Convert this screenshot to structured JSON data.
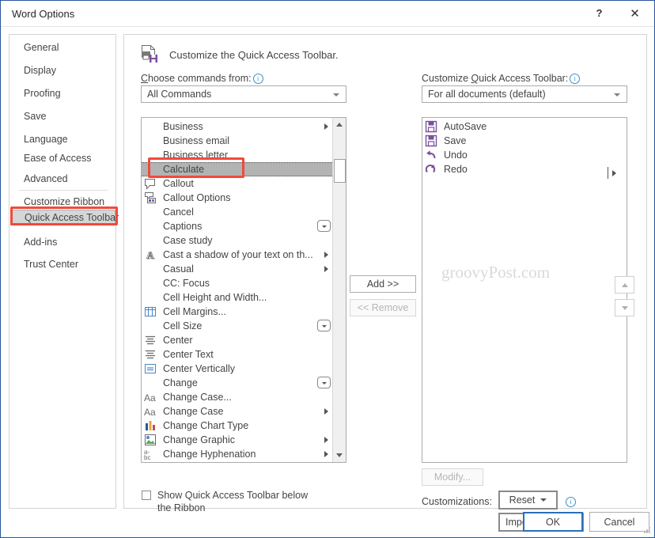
{
  "window": {
    "title": "Word Options",
    "help_label": "?",
    "close_label": "✕"
  },
  "sidebar": {
    "items": [
      {
        "label": "General",
        "selected": false
      },
      {
        "label": "Display",
        "selected": false
      },
      {
        "label": "Proofing",
        "selected": false
      },
      {
        "label": "Save",
        "selected": false
      },
      {
        "label": "Language",
        "selected": false
      },
      {
        "label": "Ease of Access",
        "selected": false
      },
      {
        "label": "Advanced",
        "selected": false
      },
      {
        "label": "Customize Ribbon",
        "selected": false
      },
      {
        "label": "Quick Access Toolbar",
        "selected": true
      },
      {
        "label": "Add-ins",
        "selected": false
      },
      {
        "label": "Trust Center",
        "selected": false
      }
    ]
  },
  "pane": {
    "heading": "Customize the Quick Access Toolbar.",
    "choose_commands_label": "Choose commands from:",
    "choose_commands_value": "All Commands",
    "customize_qat_label": "Customize Quick Access Toolbar:",
    "customize_qat_value": "For all documents (default)",
    "add_button": "Add >>",
    "remove_button": "<< Remove",
    "modify_button": "Modify...",
    "customizations_label": "Customizations:",
    "reset_button": "Reset",
    "import_export_button": "Import/Export",
    "move_up_label": "Move Up",
    "move_down_label": "Move Down",
    "show_below_ribbon_label": "Show Quick Access Toolbar below the Ribbon",
    "show_below_ribbon_checked": false,
    "watermark": "groovyPost.com"
  },
  "command_list": [
    {
      "label": "Business",
      "icon": "none",
      "submenu": true,
      "dropdown": false,
      "selected": false
    },
    {
      "label": "Business email",
      "icon": "none",
      "submenu": false,
      "dropdown": false,
      "selected": false
    },
    {
      "label": "Business letter",
      "icon": "none",
      "submenu": false,
      "dropdown": false,
      "selected": false
    },
    {
      "label": "Calculate",
      "icon": "none",
      "submenu": false,
      "dropdown": false,
      "selected": true
    },
    {
      "label": "Callout",
      "icon": "callout-icon",
      "submenu": false,
      "dropdown": false,
      "selected": false
    },
    {
      "label": "Callout Options",
      "icon": "callout-options-icon",
      "submenu": false,
      "dropdown": false,
      "selected": false
    },
    {
      "label": "Cancel",
      "icon": "none",
      "submenu": false,
      "dropdown": false,
      "selected": false
    },
    {
      "label": "Captions",
      "icon": "none",
      "submenu": false,
      "dropdown": true,
      "selected": false
    },
    {
      "label": "Case study",
      "icon": "none",
      "submenu": false,
      "dropdown": false,
      "selected": false
    },
    {
      "label": "Cast a shadow of your text on th...",
      "icon": "text-shadow-icon",
      "submenu": true,
      "dropdown": false,
      "selected": false
    },
    {
      "label": "Casual",
      "icon": "none",
      "submenu": true,
      "dropdown": false,
      "selected": false
    },
    {
      "label": "CC: Focus",
      "icon": "none",
      "submenu": false,
      "dropdown": false,
      "selected": false
    },
    {
      "label": "Cell Height and Width...",
      "icon": "none",
      "submenu": false,
      "dropdown": false,
      "selected": false
    },
    {
      "label": "Cell Margins...",
      "icon": "cell-margins-icon",
      "submenu": false,
      "dropdown": false,
      "selected": false
    },
    {
      "label": "Cell Size",
      "icon": "none",
      "submenu": false,
      "dropdown": true,
      "selected": false
    },
    {
      "label": "Center",
      "icon": "align-center-icon",
      "submenu": false,
      "dropdown": false,
      "selected": false
    },
    {
      "label": "Center Text",
      "icon": "align-center-icon",
      "submenu": false,
      "dropdown": false,
      "selected": false
    },
    {
      "label": "Center Vertically",
      "icon": "center-vertically-icon",
      "submenu": false,
      "dropdown": false,
      "selected": false
    },
    {
      "label": "Change",
      "icon": "none",
      "submenu": false,
      "dropdown": true,
      "selected": false
    },
    {
      "label": "Change Case...",
      "icon": "change-case-icon",
      "submenu": false,
      "dropdown": false,
      "selected": false
    },
    {
      "label": "Change Case",
      "icon": "change-case-icon",
      "submenu": true,
      "dropdown": false,
      "selected": false
    },
    {
      "label": "Change Chart Type",
      "icon": "chart-icon",
      "submenu": false,
      "dropdown": false,
      "selected": false
    },
    {
      "label": "Change Graphic",
      "icon": "change-graphic-icon",
      "submenu": true,
      "dropdown": false,
      "selected": false
    },
    {
      "label": "Change Hyphenation",
      "icon": "hyphenation-icon",
      "submenu": true,
      "dropdown": false,
      "selected": false
    }
  ],
  "qat_list": [
    {
      "label": "AutoSave",
      "icon": "save-icon"
    },
    {
      "label": "Save",
      "icon": "save-icon"
    },
    {
      "label": "Undo",
      "icon": "undo-icon"
    },
    {
      "label": "Redo",
      "icon": "redo-icon"
    }
  ],
  "footer": {
    "ok_label": "OK",
    "cancel_label": "Cancel"
  },
  "colors": {
    "accent": "#2a5699",
    "highlight_red": "#f04a3c",
    "selection_gray": "#b3b3b3",
    "icon_purple": "#7b4f9d"
  }
}
